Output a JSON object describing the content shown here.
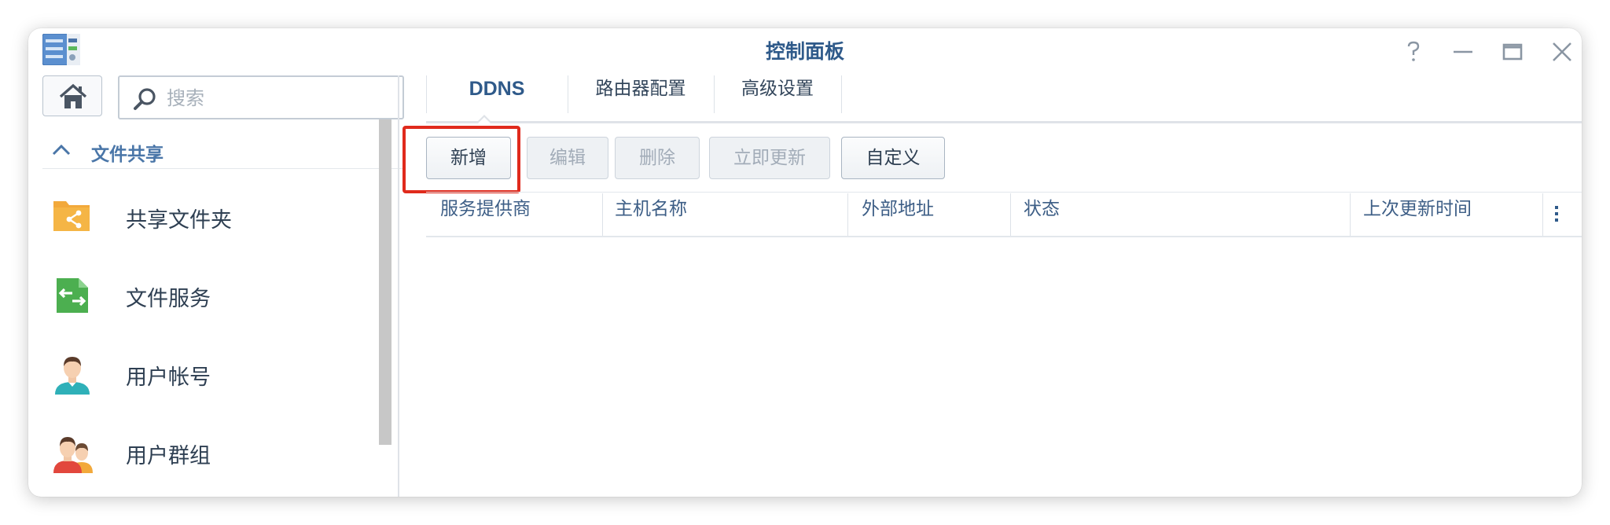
{
  "window": {
    "title": "控制面板"
  },
  "search": {
    "placeholder": "搜索"
  },
  "sidebar": {
    "section_label": "文件共享",
    "items": [
      {
        "label": "共享文件夹",
        "icon": "shared-folder-icon"
      },
      {
        "label": "文件服务",
        "icon": "file-services-icon"
      },
      {
        "label": "用户帐号",
        "icon": "user-icon"
      },
      {
        "label": "用户群组",
        "icon": "user-group-icon"
      }
    ]
  },
  "tabs": [
    {
      "label": "DDNS",
      "active": true
    },
    {
      "label": "路由器配置",
      "active": false
    },
    {
      "label": "高级设置",
      "active": false
    }
  ],
  "toolbar": {
    "add_label": "新增",
    "edit_label": "编辑",
    "delete_label": "删除",
    "update_now_label": "立即更新",
    "customize_label": "自定义"
  },
  "table": {
    "columns": [
      "服务提供商",
      "主机名称",
      "外部地址",
      "状态",
      "上次更新时间"
    ],
    "rows": []
  },
  "colors": {
    "accent": "#2f5a8a",
    "highlight_box": "#e02a1c",
    "folder_icon": "#f2a93b",
    "file_services_icon": "#4caf50"
  }
}
